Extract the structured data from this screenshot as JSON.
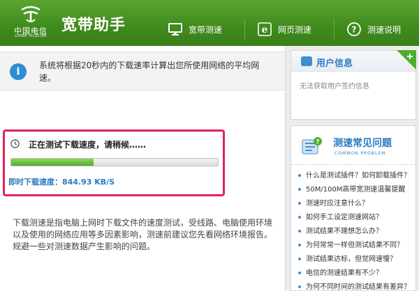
{
  "header": {
    "logo_cn": "中国电信",
    "logo_en": "CHINA TELECOM",
    "app_title": "宽带助手",
    "nav": [
      {
        "label": "宽带测速",
        "icon": "monitor-icon"
      },
      {
        "label": "网页测速",
        "icon": "browser-e-icon"
      },
      {
        "label": "测速说明",
        "icon": "help-icon"
      }
    ]
  },
  "main": {
    "tip_text": "系统将根据20秒内的下载速率计算出您所使用网络的平均网速。",
    "status_text": "正在测试下载速度，请稍候……",
    "progress_fraction": 0.4,
    "speed_label": "即时下载速度：",
    "speed_value": "844.93 KB/S",
    "description": "下载测速是指电脑上网时下载文件的速度测试，受线路、电脑使用环境以及使用的网络应用等多因素影响，测速前建议您先看网络环境报告。规避一些对测速数据产生影响的问题。"
  },
  "sidebar": {
    "user_info": {
      "title": "用户信息",
      "message": "无法获取用户签约信息"
    },
    "faq": {
      "title": "测速常见问题",
      "subtitle": "COMMON PROBLEM",
      "items": [
        "什么是测试插件？如何卸载插件？",
        "50M/100M高带宽测速温馨提醒",
        "测速时应注意什么？",
        "如何手工设定测速网站？",
        "测试结果不理想怎么办？",
        "为何常常一样但测试结果不同？",
        "测试结果达标，但觉网速慢？",
        "电信的测速结果有不少？",
        "为何不同时间的测试结果有差异？"
      ]
    }
  },
  "colors": {
    "header_green": "#3f8a1c",
    "highlight_border": "#e0215d",
    "progress_green": "#4fae2a",
    "link_blue": "#2b7ac0"
  }
}
